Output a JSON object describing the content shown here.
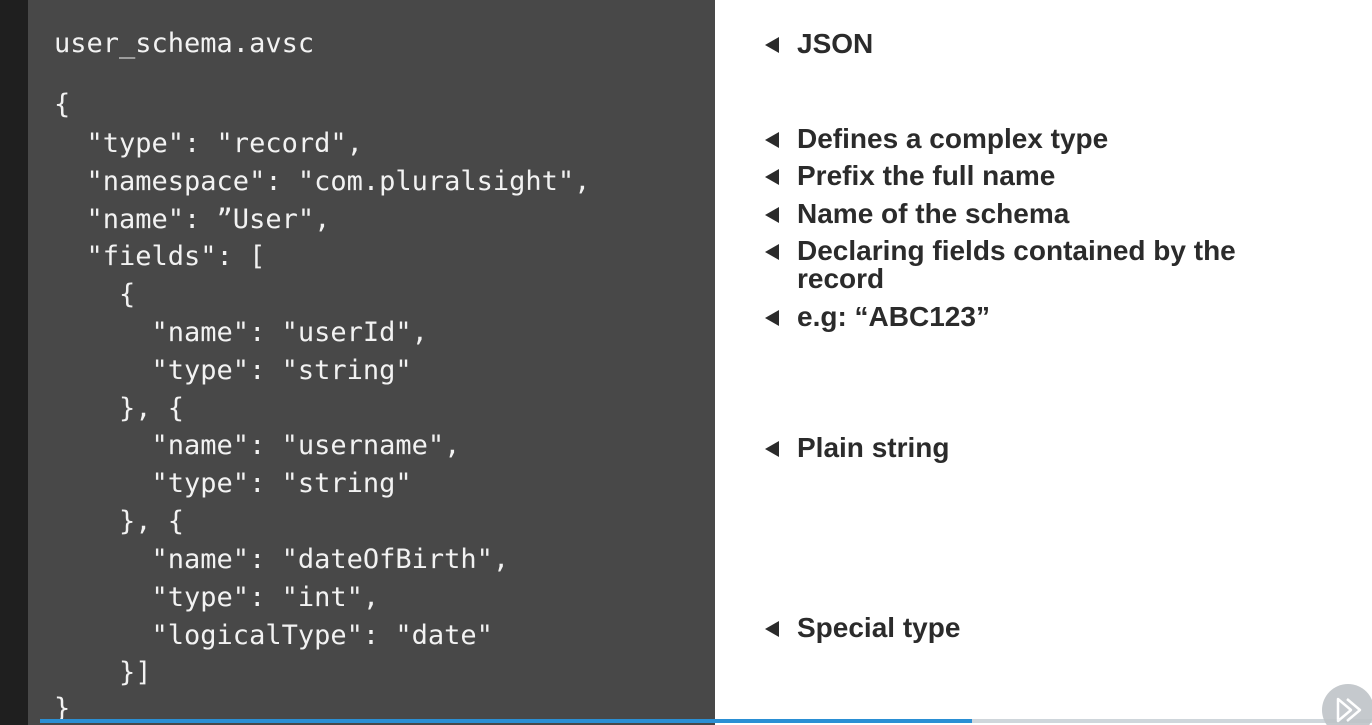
{
  "code": {
    "filename": "user_schema.avsc",
    "lines": [
      "{",
      "  \"type\": \"record\",",
      "  \"namespace\": \"com.pluralsight\",",
      "  \"name\": ”User\",",
      "  \"fields\": [",
      "    {",
      "      \"name\": \"userId\",",
      "      \"type\": \"string\"",
      "    }, {",
      "      \"name\": \"username\",",
      "      \"type\": \"string\"",
      "    }, {",
      "      \"name\": \"dateOfBirth\",",
      "      \"type\": \"int\",",
      "      \"logicalType\": \"date\"",
      "    }]",
      "}"
    ]
  },
  "annotations": [
    "JSON",
    "Defines a complex type",
    "Prefix the full name",
    "Name of the schema",
    "Declaring fields contained by the record",
    "e.g: “ABC123”",
    "Plain string",
    "Special type"
  ],
  "player": {
    "progress": 0.7,
    "play_icon": "play-forward-icon"
  },
  "colors": {
    "code_bg": "#484848",
    "code_text": "#f2f2f2",
    "note_text": "#2b2b2b",
    "progress": "#2a8fd4"
  }
}
